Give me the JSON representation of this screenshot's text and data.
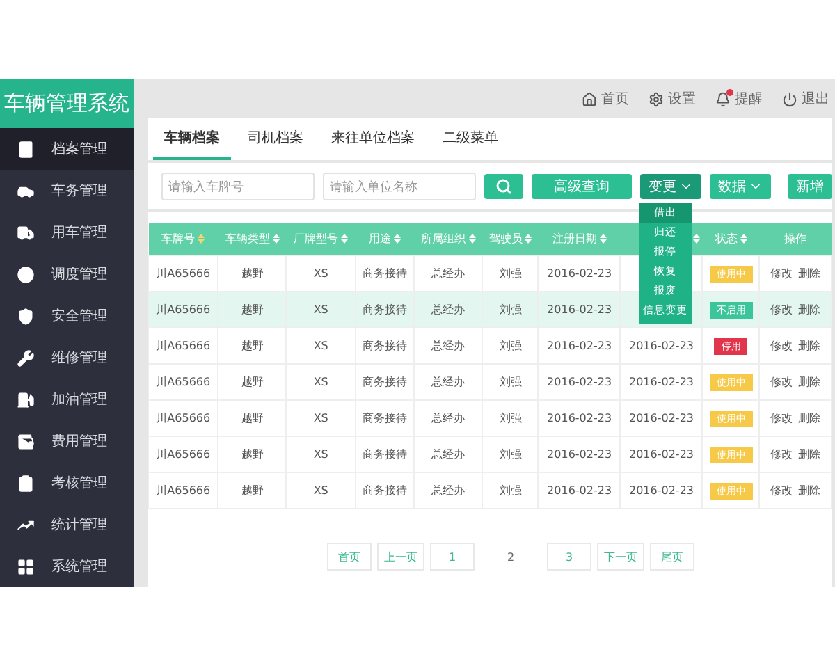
{
  "sidebar": {
    "title": "车辆管理系统",
    "items": [
      {
        "label": "档案管理",
        "selected": true
      },
      {
        "label": "车务管理",
        "selected": false
      },
      {
        "label": "用车管理",
        "selected": false
      },
      {
        "label": "调度管理",
        "selected": false
      },
      {
        "label": "安全管理",
        "selected": false
      },
      {
        "label": "维修管理",
        "selected": false
      },
      {
        "label": "加油管理",
        "selected": false
      },
      {
        "label": "费用管理",
        "selected": false
      },
      {
        "label": "考核管理",
        "selected": false
      },
      {
        "label": "统计管理",
        "selected": false
      },
      {
        "label": "系统管理",
        "selected": false
      }
    ]
  },
  "topbar": {
    "links": [
      "首页",
      "设置",
      "提醒",
      "退出"
    ]
  },
  "tabs": [
    {
      "label": "车辆档案",
      "selected": true
    },
    {
      "label": "司机档案",
      "selected": false
    },
    {
      "label": "来往单位档案",
      "selected": false
    },
    {
      "label": "二级菜单",
      "selected": false
    }
  ],
  "filters": [
    {
      "placeholder": "请输入车牌号"
    },
    {
      "placeholder": "请输入单位名称"
    }
  ],
  "buttons": [
    {
      "kind": "search"
    },
    {
      "kind": "plain",
      "label": "高级查询"
    },
    {
      "kind": "dropdown",
      "label": "变更",
      "expanded": true
    },
    {
      "kind": "dropdown",
      "label": "数据",
      "expanded": false
    },
    {
      "kind": "spacer-plain",
      "label": "新增"
    }
  ],
  "dropdown": {
    "items": [
      {
        "label": "借出",
        "selected": true
      },
      {
        "label": "归还",
        "selected": false
      },
      {
        "label": "报停",
        "selected": false
      },
      {
        "label": "恢复",
        "selected": false
      },
      {
        "label": "报废",
        "selected": false
      },
      {
        "label": "信息变更",
        "selected": false
      }
    ]
  },
  "table": {
    "columns": [
      {
        "label": "车牌号",
        "sortable": true,
        "sort_active": true
      },
      {
        "label": "车辆类型",
        "sortable": true,
        "sort_active": false
      },
      {
        "label": "厂牌型号",
        "sortable": true,
        "sort_active": false
      },
      {
        "label": "用途",
        "sortable": true,
        "sort_active": false
      },
      {
        "label": "所属组织",
        "sortable": true,
        "sort_active": false
      },
      {
        "label": "驾驶员",
        "sortable": true,
        "sort_active": false
      },
      {
        "label": "注册日期",
        "sortable": true,
        "sort_active": false
      },
      {
        "sortable": true
      },
      {
        "label": "状态",
        "sortable": true,
        "sort_active": false
      },
      {
        "label": "操作",
        "sortable": false
      }
    ],
    "rows": [
      {
        "selected": false,
        "cells": [
          "川A65666",
          "越野",
          "XS",
          "商务接待",
          "总经办",
          "刘强",
          "2016-02-23",
          null
        ],
        "status": {
          "label": "使用中",
          "color": "#f7c948"
        },
        "actions": [
          "修改",
          "删除"
        ]
      },
      {
        "selected": true,
        "cells": [
          "川A65666",
          "越野",
          "XS",
          "商务接待",
          "总经办",
          "刘强",
          "2016-02-23",
          null
        ],
        "status": {
          "label": "不启用",
          "color": "#3cc49a"
        },
        "actions": [
          "修改",
          "删除"
        ]
      },
      {
        "selected": false,
        "cells": [
          "川A65666",
          "越野",
          "XS",
          "商务接待",
          "总经办",
          "刘强",
          "2016-02-23",
          "2016-02-23"
        ],
        "status": {
          "label": "停用",
          "color": "#e0354b"
        },
        "actions": [
          "修改",
          "删除"
        ]
      },
      {
        "selected": false,
        "cells": [
          "川A65666",
          "越野",
          "XS",
          "商务接待",
          "总经办",
          "刘强",
          "2016-02-23",
          "2016-02-23"
        ],
        "status": {
          "label": "使用中",
          "color": "#f7c948"
        },
        "actions": [
          "修改",
          "删除"
        ]
      },
      {
        "selected": false,
        "cells": [
          "川A65666",
          "越野",
          "XS",
          "商务接待",
          "总经办",
          "刘强",
          "2016-02-23",
          "2016-02-23"
        ],
        "status": {
          "label": "使用中",
          "color": "#f7c948"
        },
        "actions": [
          "修改",
          "删除"
        ]
      },
      {
        "selected": false,
        "cells": [
          "川A65666",
          "越野",
          "XS",
          "商务接待",
          "总经办",
          "刘强",
          "2016-02-23",
          "2016-02-23"
        ],
        "status": {
          "label": "使用中",
          "color": "#f7c948"
        },
        "actions": [
          "修改",
          "删除"
        ]
      },
      {
        "selected": false,
        "cells": [
          "川A65666",
          "越野",
          "XS",
          "商务接待",
          "总经办",
          "刘强",
          "2016-02-23",
          "2016-02-23"
        ],
        "status": {
          "label": "使用中",
          "color": "#f7c948"
        },
        "actions": [
          "修改",
          "删除"
        ]
      }
    ]
  },
  "pagination": [
    {
      "label": "首页",
      "selected": false
    },
    {
      "label": "上一页",
      "selected": false
    },
    {
      "label": "1",
      "selected": false
    },
    {
      "label": "2",
      "selected": true
    },
    {
      "label": "3",
      "selected": false
    },
    {
      "label": "下一页",
      "selected": false
    },
    {
      "label": "尾页",
      "selected": false
    }
  ]
}
